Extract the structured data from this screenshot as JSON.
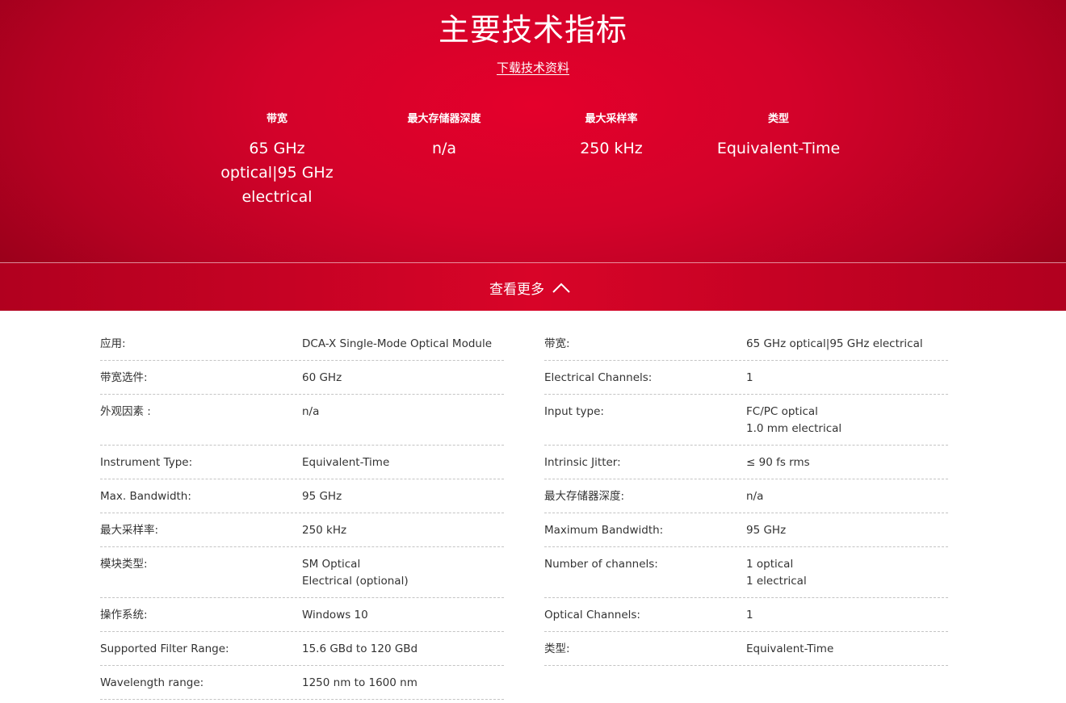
{
  "hero": {
    "title": "主要技术指标",
    "download_label": "下载技术资料",
    "specs": [
      {
        "label": "带宽",
        "value": "65 GHz optical|95 GHz electrical"
      },
      {
        "label": "最大存储器深度",
        "value": "n/a"
      },
      {
        "label": "最大采样率",
        "value": "250 kHz"
      },
      {
        "label": "类型",
        "value": "Equivalent-Time"
      }
    ]
  },
  "more": {
    "label": "查看更多",
    "icon": "chevron-up-icon"
  },
  "table": {
    "left": [
      {
        "key": "应用:",
        "value": "DCA-X Single-Mode Optical Module"
      },
      {
        "key": "带宽选件:",
        "value": "60 GHz"
      },
      {
        "key": "外观因素 :",
        "value": "n/a"
      },
      {
        "key": "Instrument Type:",
        "value": "Equivalent-Time"
      },
      {
        "key": "Max. Bandwidth:",
        "value": "95 GHz"
      },
      {
        "key": "最大采样率:",
        "value": "250 kHz"
      },
      {
        "key": "模块类型:",
        "value": "SM Optical\nElectrical (optional)"
      },
      {
        "key": "操作系统:",
        "value": "Windows 10"
      },
      {
        "key": "Supported Filter Range:",
        "value": "15.6 GBd to 120 GBd"
      },
      {
        "key": "Wavelength range:",
        "value": "1250 nm to 1600 nm"
      }
    ],
    "right": [
      {
        "key": "带宽:",
        "value": "65 GHz optical|95 GHz electrical"
      },
      {
        "key": "Electrical Channels:",
        "value": "1"
      },
      {
        "key": "Input type:",
        "value": "FC/PC optical\n1.0 mm electrical"
      },
      {
        "key": "Intrinsic Jitter:",
        "value": "≤ 90 fs rms"
      },
      {
        "key": "最大存储器深度:",
        "value": "n/a"
      },
      {
        "key": "Maximum Bandwidth:",
        "value": "95 GHz"
      },
      {
        "key": "Number of channels:",
        "value": "1 optical\n1 electrical"
      },
      {
        "key": "Optical Channels:",
        "value": "1"
      },
      {
        "key": "类型:",
        "value": "Equivalent-Time"
      }
    ]
  },
  "colors": {
    "brand_red": "#e4002b",
    "dark_red": "#960019",
    "text": "#333333",
    "divider": "#c4c4c4"
  }
}
